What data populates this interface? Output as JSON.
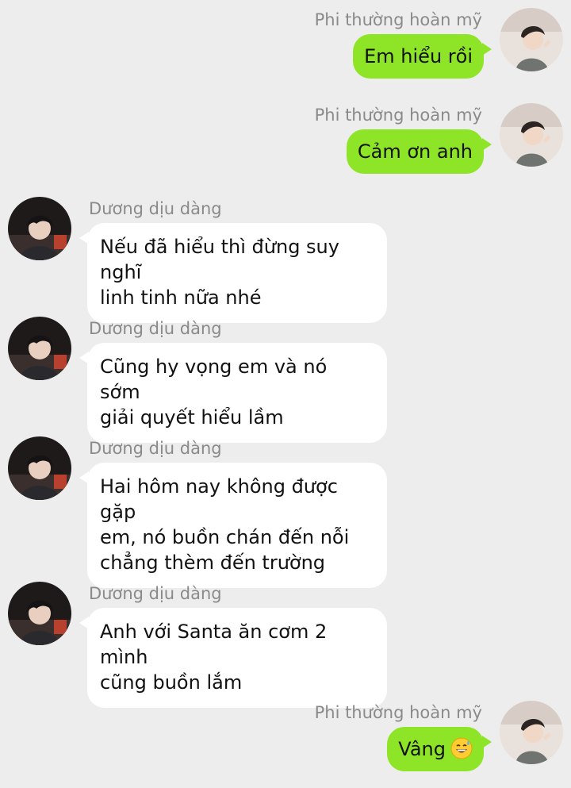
{
  "contacts": {
    "me": {
      "name": "Phi thường hoàn mỹ",
      "avatar": "boy-photo-avatar"
    },
    "them": {
      "name": "Dương dịu dàng",
      "avatar": "boy-photo-avatar"
    }
  },
  "messages": [
    {
      "sender": "me",
      "name": "Phi thường hoàn mỹ",
      "lines": [
        "Em hiểu rồi"
      ]
    },
    {
      "sender": "me",
      "name": "Phi thường hoàn mỹ",
      "lines": [
        "Cảm ơn anh"
      ]
    },
    {
      "sender": "them",
      "name": "Dương dịu dàng",
      "lines": [
        "Nếu đã hiểu thì đừng suy nghĩ",
        "linh tinh nữa nhé"
      ]
    },
    {
      "sender": "them",
      "name": "Dương dịu dàng",
      "lines": [
        "Cũng hy vọng em và nó sớm",
        "giải quyết hiểu lầm"
      ]
    },
    {
      "sender": "them",
      "name": "Dương dịu dàng",
      "lines": [
        "Hai hôm nay không được gặp",
        "em, nó buồn chán đến nỗi",
        "chẳng thèm đến trường"
      ]
    },
    {
      "sender": "them",
      "name": "Dương dịu dàng",
      "lines": [
        "Anh với Santa ăn cơm 2 mình",
        "cũng buồn lắm"
      ]
    },
    {
      "sender": "me",
      "name": "Phi thường hoàn mỹ",
      "lines": [
        "Vâng"
      ],
      "emoji": "grinning-sweat-emoji"
    }
  ],
  "colors": {
    "background": "#ededed",
    "outgoing_bubble": "#8ee427",
    "incoming_bubble": "#ffffff",
    "name_text": "#8a8a8a"
  }
}
